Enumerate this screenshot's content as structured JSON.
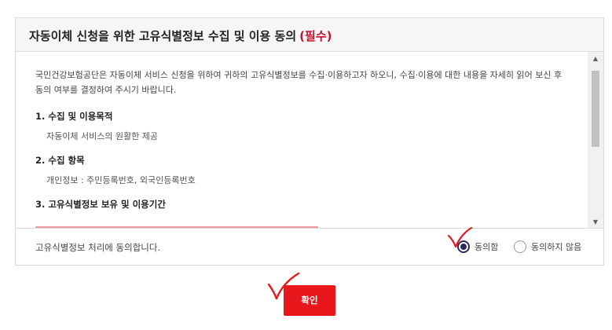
{
  "header": {
    "title": "자동이체 신청을 위한 고유식별정보 수집 및 이용 동의",
    "required_tag": "(필수)"
  },
  "content": {
    "intro": "국민건강보험공단은 자동이체 서비스 신청을 위하여 귀하의 고유식별정보를 수집·이용하고자 하오니, 수집·이용에 대한 내용을 자세히 읽어 보신 후 동의 여부를 결정하여 주시기 바랍니다.",
    "sections": [
      {
        "title": "1. 수집 및 이용목적",
        "body": "자동이체 서비스의 원활한 제공"
      },
      {
        "title": "2. 수집 항목",
        "body": "개인정보 : 주민등록번호, 외국인등록번호"
      },
      {
        "title": "3. 고유식별정보 보유 및 이용기간",
        "body": ""
      }
    ]
  },
  "agreement": {
    "label": "고유식별정보 처리에 동의합니다.",
    "options": [
      {
        "label": "동의함",
        "checked": true
      },
      {
        "label": "동의하지 않음",
        "checked": false
      }
    ]
  },
  "confirm_button": {
    "label": "확인"
  },
  "colors": {
    "accent": "#e8171b",
    "required": "#c8102e",
    "radio_checked": "#2a2a5a",
    "annotation": "#e8171b"
  }
}
